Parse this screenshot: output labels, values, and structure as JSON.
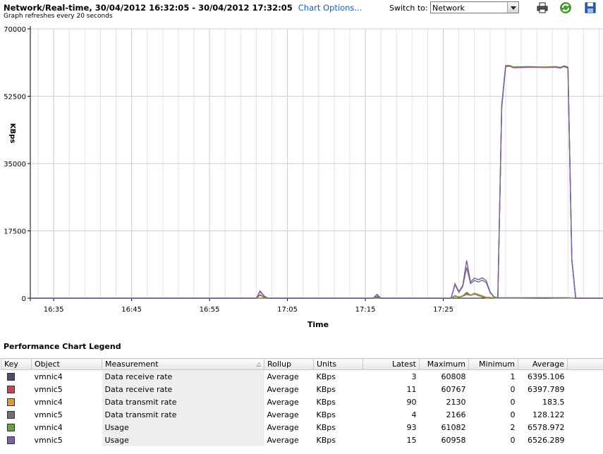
{
  "header": {
    "title": "Network/Real-time, 30/04/2012 16:32:05 - 30/04/2012 17:32:05",
    "chart_options_link": "Chart Options...",
    "subtitle": "Graph refreshes every 20 seconds",
    "switch_label": "Switch to:",
    "switch_value": "Network"
  },
  "toolbar": {
    "icons": [
      "print-icon",
      "refresh-icon",
      "save-icon"
    ]
  },
  "chart_data": {
    "type": "line",
    "xlabel": "Time",
    "ylabel": "KBps",
    "ylim": [
      0,
      70000
    ],
    "y_ticks": [
      "70000",
      "52500",
      "35000",
      "17500",
      "0"
    ],
    "x_ticks": [
      "16:35",
      "16:45",
      "16:55",
      "17:05",
      "17:15",
      "17:25"
    ],
    "x_unit": "minutes from 16:32",
    "grid": true,
    "series": [
      {
        "name": "vmnic4 Data receive rate",
        "color": "#4b4b6b",
        "points": [
          [
            0,
            0
          ],
          [
            29,
            0
          ],
          [
            29.5,
            900
          ],
          [
            30,
            200
          ],
          [
            30.5,
            0
          ],
          [
            44,
            0
          ],
          [
            44.5,
            400
          ],
          [
            45,
            0
          ],
          [
            54,
            0
          ],
          [
            54.5,
            500
          ],
          [
            55,
            300
          ],
          [
            55.5,
            600
          ],
          [
            56,
            1400
          ],
          [
            56.5,
            700
          ],
          [
            57,
            1100
          ],
          [
            57.5,
            700
          ],
          [
            58,
            400
          ],
          [
            58.5,
            100
          ],
          [
            59,
            0
          ],
          [
            60,
            50
          ],
          [
            60.5,
            50000
          ],
          [
            61,
            60300
          ],
          [
            61.5,
            60400
          ],
          [
            62,
            60000
          ],
          [
            64,
            60100
          ],
          [
            66,
            60000
          ],
          [
            67.5,
            60100
          ],
          [
            68,
            59900
          ],
          [
            68.5,
            60300
          ],
          [
            69,
            60000
          ],
          [
            69.5,
            10000
          ],
          [
            70,
            0
          ],
          [
            75,
            0
          ]
        ]
      },
      {
        "name": "vmnic5 Data receive rate",
        "color": "#c04a5a",
        "points": [
          [
            0,
            0
          ],
          [
            29,
            0
          ],
          [
            29.5,
            800
          ],
          [
            30,
            200
          ],
          [
            30.5,
            0
          ],
          [
            44,
            0
          ],
          [
            44.5,
            300
          ],
          [
            45,
            0
          ],
          [
            54,
            0
          ],
          [
            54.5,
            600
          ],
          [
            55,
            300
          ],
          [
            55.5,
            500
          ],
          [
            56,
            1500
          ],
          [
            56.5,
            800
          ],
          [
            57,
            1000
          ],
          [
            57.5,
            800
          ],
          [
            58,
            300
          ],
          [
            58.5,
            100
          ],
          [
            59,
            0
          ],
          [
            60,
            40
          ],
          [
            60.5,
            49500
          ],
          [
            61,
            60200
          ],
          [
            61.5,
            60300
          ],
          [
            62,
            59900
          ],
          [
            64,
            60000
          ],
          [
            66,
            60000
          ],
          [
            67.5,
            60000
          ],
          [
            68,
            59800
          ],
          [
            68.5,
            60200
          ],
          [
            69,
            59800
          ],
          [
            69.5,
            9800
          ],
          [
            70,
            0
          ],
          [
            75,
            0
          ]
        ]
      },
      {
        "name": "vmnic4 Data transmit rate",
        "color": "#d99a40",
        "points": [
          [
            0,
            0
          ],
          [
            54,
            0
          ],
          [
            54.5,
            600
          ],
          [
            55,
            200
          ],
          [
            55.5,
            500
          ],
          [
            56,
            900
          ],
          [
            56.5,
            700
          ],
          [
            57,
            1200
          ],
          [
            57.5,
            900
          ],
          [
            58,
            500
          ],
          [
            58.5,
            200
          ],
          [
            59,
            150
          ],
          [
            60,
            100
          ],
          [
            62,
            100
          ],
          [
            66,
            120
          ],
          [
            69,
            100
          ],
          [
            70,
            0
          ],
          [
            75,
            0
          ]
        ]
      },
      {
        "name": "vmnic5 Data transmit rate",
        "color": "#707078",
        "points": [
          [
            0,
            0
          ],
          [
            29,
            0
          ],
          [
            29.5,
            1700
          ],
          [
            30,
            500
          ],
          [
            30.5,
            0
          ],
          [
            44,
            0
          ],
          [
            44.5,
            900
          ],
          [
            45,
            0
          ],
          [
            54,
            0
          ],
          [
            54.5,
            3500
          ],
          [
            55,
            1500
          ],
          [
            55.5,
            3000
          ],
          [
            56,
            8000
          ],
          [
            56.5,
            3800
          ],
          [
            57,
            4600
          ],
          [
            57.5,
            4200
          ],
          [
            58,
            4700
          ],
          [
            58.5,
            4100
          ],
          [
            59,
            1500
          ],
          [
            59.5,
            300
          ],
          [
            60,
            100
          ],
          [
            62,
            100
          ],
          [
            66,
            120
          ],
          [
            69,
            100
          ],
          [
            70,
            0
          ],
          [
            75,
            0
          ]
        ]
      },
      {
        "name": "vmnic4 Usage",
        "color": "#6e9e40",
        "points": [
          [
            0,
            0
          ],
          [
            54,
            0
          ],
          [
            54.5,
            700
          ],
          [
            55,
            250
          ],
          [
            55.5,
            600
          ],
          [
            56,
            1000
          ],
          [
            56.5,
            800
          ],
          [
            57,
            1300
          ],
          [
            57.5,
            1000
          ],
          [
            58,
            600
          ],
          [
            58.5,
            250
          ],
          [
            59,
            180
          ],
          [
            60,
            120
          ],
          [
            60.5,
            50200
          ],
          [
            61,
            60500
          ],
          [
            61.5,
            60500
          ],
          [
            62,
            60100
          ],
          [
            64,
            60200
          ],
          [
            66,
            60100
          ],
          [
            67.5,
            60200
          ],
          [
            68,
            60000
          ],
          [
            68.5,
            60400
          ],
          [
            69,
            60100
          ],
          [
            69.5,
            10100
          ],
          [
            70,
            0
          ],
          [
            75,
            0
          ]
        ]
      },
      {
        "name": "vmnic5 Usage",
        "color": "#8060a0",
        "points": [
          [
            0,
            0
          ],
          [
            29,
            0
          ],
          [
            29.5,
            1900
          ],
          [
            30,
            600
          ],
          [
            30.5,
            0
          ],
          [
            44,
            0
          ],
          [
            44.5,
            1000
          ],
          [
            45,
            0
          ],
          [
            54,
            0
          ],
          [
            54.5,
            3800
          ],
          [
            55,
            1700
          ],
          [
            55.5,
            3300
          ],
          [
            56,
            9800
          ],
          [
            56.5,
            4200
          ],
          [
            57,
            5200
          ],
          [
            57.5,
            4800
          ],
          [
            58,
            5300
          ],
          [
            58.5,
            4600
          ],
          [
            59,
            1700
          ],
          [
            59.5,
            350
          ],
          [
            60,
            120
          ],
          [
            60.5,
            49800
          ],
          [
            61,
            60300
          ],
          [
            61.5,
            60400
          ],
          [
            62,
            60000
          ],
          [
            64,
            60100
          ],
          [
            66,
            60000
          ],
          [
            67.5,
            60100
          ],
          [
            68,
            59900
          ],
          [
            68.5,
            60300
          ],
          [
            69,
            60000
          ],
          [
            69.5,
            10000
          ],
          [
            70,
            0
          ],
          [
            75,
            0
          ]
        ]
      }
    ]
  },
  "legend": {
    "title": "Performance Chart Legend",
    "columns": [
      "Key",
      "Object",
      "Measurement",
      "Rollup",
      "Units",
      "Latest",
      "Maximum",
      "Minimum",
      "Average"
    ],
    "rows": [
      {
        "color": "#4b4b6b",
        "object": "vmnic4",
        "measurement": "Data receive rate",
        "rollup": "Average",
        "units": "KBps",
        "latest": "3",
        "maximum": "60808",
        "minimum": "1",
        "average": "6395.106"
      },
      {
        "color": "#c04a5a",
        "object": "vmnic5",
        "measurement": "Data receive rate",
        "rollup": "Average",
        "units": "KBps",
        "latest": "11",
        "maximum": "60767",
        "minimum": "0",
        "average": "6397.789"
      },
      {
        "color": "#d99a40",
        "object": "vmnic4",
        "measurement": "Data transmit rate",
        "rollup": "Average",
        "units": "KBps",
        "latest": "90",
        "maximum": "2130",
        "minimum": "0",
        "average": "183.5"
      },
      {
        "color": "#707078",
        "object": "vmnic5",
        "measurement": "Data transmit rate",
        "rollup": "Average",
        "units": "KBps",
        "latest": "4",
        "maximum": "2166",
        "minimum": "0",
        "average": "128.122"
      },
      {
        "color": "#6e9e40",
        "object": "vmnic4",
        "measurement": "Usage",
        "rollup": "Average",
        "units": "KBps",
        "latest": "93",
        "maximum": "61082",
        "minimum": "2",
        "average": "6578.972"
      },
      {
        "color": "#8060a0",
        "object": "vmnic5",
        "measurement": "Usage",
        "rollup": "Average",
        "units": "KBps",
        "latest": "15",
        "maximum": "60958",
        "minimum": "0",
        "average": "6526.289"
      }
    ]
  }
}
